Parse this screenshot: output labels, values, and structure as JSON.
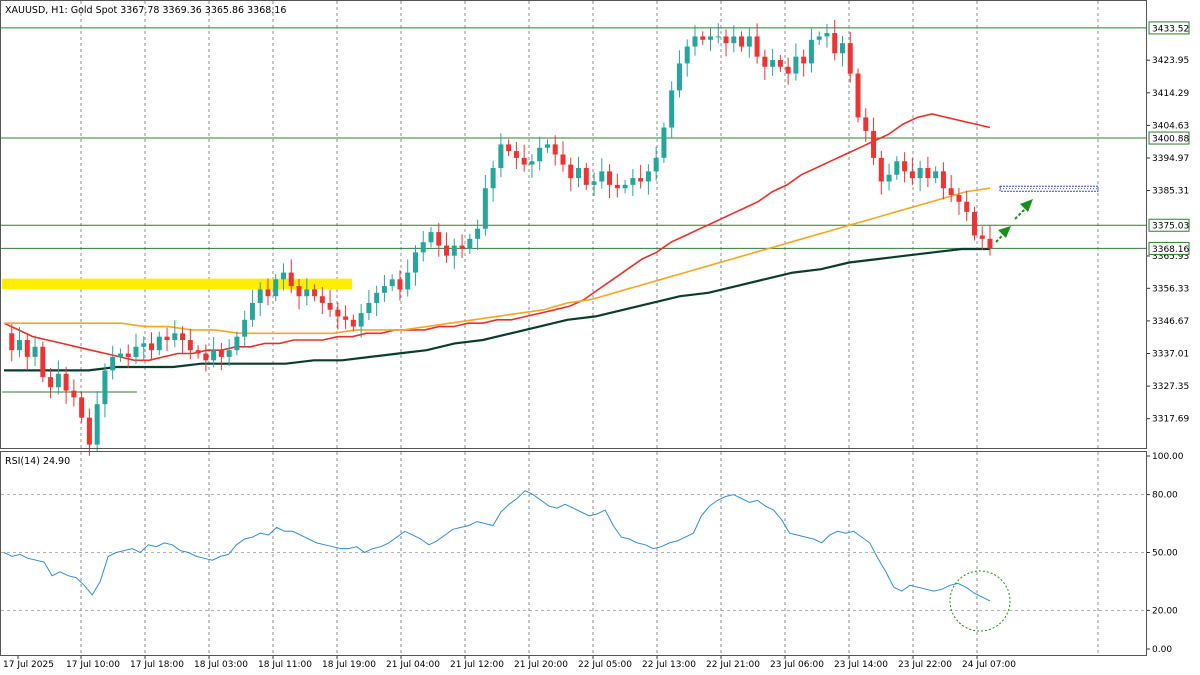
{
  "header": {
    "symbol": "XAUUSD, H1:  Gold Spot  3367.78 3369.36 3365.86 3368.16"
  },
  "rsi_header": "RSI(14) 24.90",
  "colors": {
    "bull": "#26a69a",
    "bear": "#ef3333",
    "ma_fast": "#e8302a",
    "ma_mid": "#f5a623",
    "ma_slow": "#0b3d2e",
    "level_line": "#2e7d32",
    "rsi_line": "#2f8fd8",
    "highlight": "#ffee00",
    "arrow": "#1a8f1a",
    "target": "#3344cc"
  },
  "chart_data": [
    {
      "type": "candlestick",
      "title": "XAUUSD, H1: Gold Spot",
      "ylim": [
        3309.0,
        3441.5
      ],
      "price_tick_labels": [
        "3423.95",
        "3414.29",
        "3404.63",
        "3394.97",
        "3385.31",
        "3365.93",
        "3356.33",
        "3346.67",
        "3337.01",
        "3327.35",
        "3317.69"
      ],
      "price_ticks": [
        3423.95,
        3414.29,
        3404.63,
        3394.97,
        3385.31,
        3365.93,
        3356.33,
        3346.67,
        3337.01,
        3327.35,
        3317.69
      ],
      "level_tags": [
        {
          "label": "3433.52",
          "value": 3433.52
        },
        {
          "label": "3400.88",
          "value": 3400.88
        },
        {
          "label": "3375.03",
          "value": 3375.03
        },
        {
          "label": "3368.16",
          "value": 3368.16
        }
      ],
      "x_tick_labels": [
        "17 Jul 2025",
        "17 Jul 10:00",
        "17 Jul 18:00",
        "18 Jul 03:00",
        "18 Jul 11:00",
        "18 Jul 19:00",
        "21 Jul 04:00",
        "21 Jul 12:00",
        "21 Jul 20:00",
        "22 Jul 05:00",
        "22 Jul 13:00",
        "22 Jul 21:00",
        "23 Jul 06:00",
        "23 Jul 14:00",
        "23 Jul 22:00",
        "24 Jul 07:00"
      ],
      "price_path": [
        3343,
        3338,
        3341,
        3336,
        3339,
        3330,
        3327,
        3331,
        3326,
        3324,
        3318,
        3310,
        3322,
        3332,
        3336,
        3337,
        3336,
        3339,
        3340,
        3338,
        3342,
        3341,
        3343,
        3341,
        3338,
        3337,
        3335,
        3338,
        3336,
        3338,
        3342,
        3347,
        3352,
        3356,
        3354,
        3359,
        3361,
        3357,
        3354,
        3356,
        3354,
        3352,
        3350,
        3348,
        3347,
        3345,
        3349,
        3352,
        3355,
        3357,
        3359,
        3356,
        3361,
        3367,
        3370,
        3373,
        3369,
        3366,
        3369,
        3368,
        3371,
        3374,
        3386,
        3392,
        3399,
        3397,
        3395,
        3393,
        3394,
        3398,
        3399,
        3396,
        3393,
        3389,
        3392,
        3387,
        3388,
        3391,
        3387,
        3386,
        3387,
        3389,
        3388,
        3391,
        3395,
        3404,
        3415,
        3423,
        3428,
        3431,
        3430,
        3431,
        3431,
        3429,
        3431,
        3428,
        3431,
        3425,
        3422,
        3424,
        3422,
        3420,
        3425,
        3423,
        3430,
        3431,
        3432,
        3426,
        3429,
        3420,
        3407,
        3403,
        3395,
        3388,
        3390,
        3394,
        3391,
        3389,
        3392,
        3389,
        3391,
        3386,
        3384,
        3382,
        3379,
        3372,
        3371,
        3368.16
      ],
      "moving_averages": [
        {
          "name": "MA fast",
          "values": [
            3346,
            3344,
            3342,
            3341,
            3340,
            3339,
            3338,
            3337,
            3336,
            3335,
            3335,
            3336,
            3337,
            3337,
            3338,
            3338,
            3339,
            3339,
            3340,
            3340,
            3341,
            3341,
            3341,
            3342,
            3342,
            3343,
            3343,
            3344,
            3344,
            3344,
            3345,
            3345,
            3346,
            3346,
            3347,
            3347,
            3348,
            3349,
            3350,
            3351,
            3353,
            3356,
            3359,
            3362,
            3365,
            3367,
            3370,
            3372,
            3374,
            3376,
            3378,
            3380,
            3382,
            3385,
            3387,
            3390,
            3392,
            3394,
            3396,
            3398,
            3400,
            3402,
            3405,
            3407,
            3408,
            3407,
            3406,
            3405,
            3404
          ]
        },
        {
          "name": "MA mid",
          "values": [
            3346,
            3346,
            3346,
            3346,
            3346,
            3346,
            3345,
            3345,
            3344,
            3344,
            3343,
            3343,
            3343,
            3343,
            3343,
            3344,
            3344,
            3344,
            3345,
            3346,
            3347,
            3348,
            3349,
            3350,
            3352,
            3353,
            3355,
            3357,
            3359,
            3361,
            3363,
            3365,
            3367,
            3369,
            3371,
            3373,
            3375,
            3377,
            3379,
            3381,
            3383,
            3385,
            3386
          ]
        },
        {
          "name": "MA slow",
          "values": [
            3332,
            3332,
            3332,
            3332,
            3333,
            3333,
            3333,
            3334,
            3334,
            3334,
            3334,
            3335,
            3335,
            3336,
            3337,
            3338,
            3340,
            3341,
            3343,
            3345,
            3347,
            3348,
            3350,
            3352,
            3354,
            3355,
            3357,
            3359,
            3361,
            3362,
            3364,
            3365,
            3366,
            3367,
            3368,
            3368
          ]
        }
      ]
    },
    {
      "type": "line",
      "title": "RSI(14) 24.90",
      "ylim": [
        0,
        100
      ],
      "tick_labels": [
        "100.00",
        "80.00",
        "50.00",
        "20.00",
        "0.00"
      ],
      "ticks": [
        100,
        80,
        50,
        20,
        0
      ],
      "values": [
        50,
        48,
        49,
        47,
        46,
        45,
        38,
        40,
        38,
        37,
        33,
        28,
        35,
        48,
        50,
        51,
        52,
        50,
        54,
        53,
        55,
        54,
        51,
        50,
        48,
        47,
        46,
        48,
        49,
        54,
        57,
        58,
        60,
        59,
        63,
        61,
        61,
        59,
        57,
        55,
        54,
        53,
        52,
        52,
        53,
        50,
        52,
        53,
        55,
        58,
        61,
        59,
        57,
        54,
        56,
        59,
        62,
        63,
        64,
        66,
        65,
        64,
        71,
        75,
        78,
        82,
        80,
        77,
        74,
        73,
        75,
        73,
        71,
        69,
        70,
        72,
        64,
        58,
        57,
        55,
        54,
        52,
        53,
        55,
        56,
        58,
        60,
        69,
        74,
        77,
        79,
        80,
        78,
        76,
        77,
        74,
        72,
        67,
        60,
        59,
        58,
        57,
        55,
        59,
        61,
        60,
        61,
        58,
        55,
        47,
        40,
        32,
        30,
        33,
        32,
        31,
        30,
        31,
        33,
        34,
        32,
        29,
        27,
        24.9
      ]
    }
  ]
}
